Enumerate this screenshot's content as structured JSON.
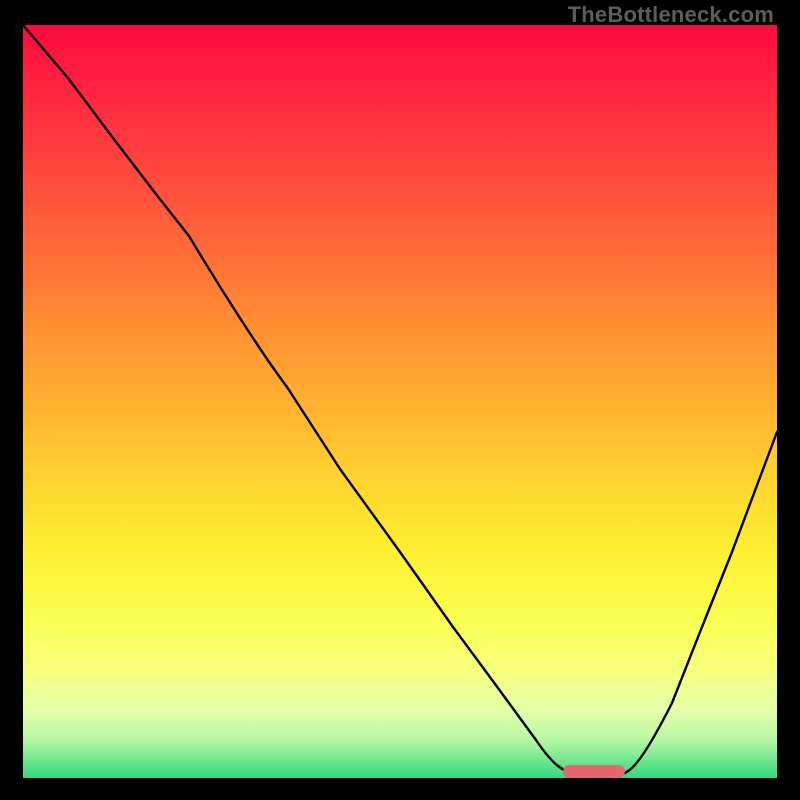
{
  "watermark": "TheBottleneck.com",
  "chart_data": {
    "type": "line",
    "title": "",
    "xlabel": "",
    "ylabel": "",
    "xlim": [
      0,
      100
    ],
    "ylim": [
      0,
      100
    ],
    "grid": false,
    "legend": false,
    "background_gradient": {
      "orientation": "vertical",
      "stops": [
        {
          "pos": 0.0,
          "color": "#ff0a3e"
        },
        {
          "pos": 0.25,
          "color": "#ff5a3a"
        },
        {
          "pos": 0.5,
          "color": "#ffb030"
        },
        {
          "pos": 0.7,
          "color": "#fdf032"
        },
        {
          "pos": 0.86,
          "color": "#f6ff7e"
        },
        {
          "pos": 0.95,
          "color": "#b6f8a4"
        },
        {
          "pos": 1.0,
          "color": "#34d97f"
        }
      ]
    },
    "series": [
      {
        "name": "bottleneck-curve",
        "x": [
          0,
          6,
          12,
          18,
          22,
          28,
          35,
          42,
          50,
          57,
          63,
          68,
          71,
          74,
          78,
          82,
          86,
          90,
          94,
          100
        ],
        "y": [
          100,
          93,
          85,
          77,
          72,
          63,
          52,
          41,
          30,
          20,
          12,
          5,
          1,
          0,
          0,
          2,
          10,
          20,
          30,
          46
        ]
      }
    ],
    "marker": {
      "name": "optimal-range",
      "shape": "rounded-bar",
      "color": "#e2676f",
      "x_range": [
        72,
        80
      ],
      "y": 0.5
    },
    "notes": "Heat-style background runs from red (high bottleneck) at top to green (no bottleneck) at bottom. The black curve is the bottleneck percentage; the short pink bar at the valley marks the recommended/optimal region."
  }
}
